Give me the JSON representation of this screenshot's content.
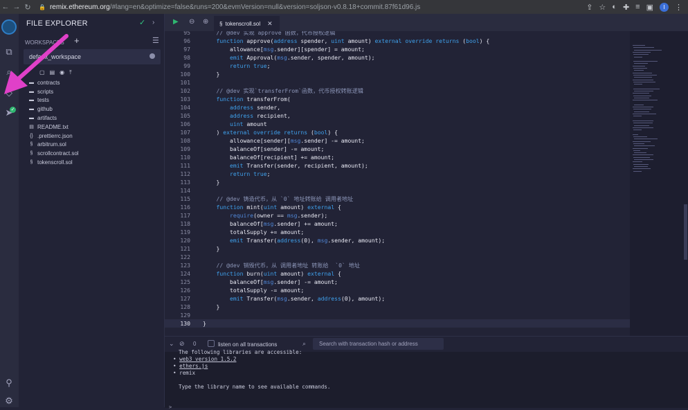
{
  "browser": {
    "url_host": "remix.ethereum.org",
    "url_rest": "/#lang=en&optimize=false&runs=200&evmVersion=null&version=soljson-v0.8.18+commit.87f61d96.js",
    "profile_initial": "I"
  },
  "explorer": {
    "title": "FILE EXPLORER",
    "workspaces_label": "WORKSPACES",
    "workspace_name": "default_workspace",
    "items": [
      {
        "name": "contracts",
        "icon": "folder-icon"
      },
      {
        "name": "scripts",
        "icon": "folder-icon"
      },
      {
        "name": "tests",
        "icon": "folder-icon"
      },
      {
        "name": "github",
        "icon": "folder-icon"
      },
      {
        "name": "artifacts",
        "icon": "folder-icon"
      },
      {
        "name": "README.txt",
        "icon": "file-text-icon"
      },
      {
        "name": ".prettierrc.json",
        "icon": "json-icon"
      },
      {
        "name": "arbitrum.sol",
        "icon": "solidity-icon"
      },
      {
        "name": "scrollcontract.sol",
        "icon": "solidity-icon"
      },
      {
        "name": "tokenscroll.sol",
        "icon": "solidity-icon"
      }
    ]
  },
  "editor": {
    "tab_name": "tokenscroll.sol",
    "active_line": 130,
    "lines": [
      {
        "n": 95,
        "tokens": [
          [
            "cm",
            "    // @dev 实现`approve`函数，代币授权逻辑"
          ]
        ]
      },
      {
        "n": 96,
        "tokens": [
          [
            "kw",
            "    function "
          ],
          [
            "nm",
            "approve("
          ],
          [
            "ty",
            "address "
          ],
          [
            "nm",
            "spender, "
          ],
          [
            "ty",
            "uint "
          ],
          [
            "nm",
            "amount) "
          ],
          [
            "kw",
            "external override returns "
          ],
          [
            "nm",
            "("
          ],
          [
            "ty",
            "bool"
          ],
          [
            "nm",
            ") {"
          ]
        ]
      },
      {
        "n": 97,
        "tokens": [
          [
            "nm",
            "        allowance["
          ],
          [
            "bi",
            "msg"
          ],
          [
            "nm",
            ".sender][spender] = amount;"
          ]
        ]
      },
      {
        "n": 98,
        "tokens": [
          [
            "kw",
            "        emit "
          ],
          [
            "nm",
            "Approval("
          ],
          [
            "bi",
            "msg"
          ],
          [
            "nm",
            ".sender, spender, amount);"
          ]
        ]
      },
      {
        "n": 99,
        "tokens": [
          [
            "kw",
            "        return true"
          ],
          [
            "nm",
            ";"
          ]
        ]
      },
      {
        "n": 100,
        "tokens": [
          [
            "nm",
            "    }"
          ]
        ]
      },
      {
        "n": 101,
        "tokens": []
      },
      {
        "n": 102,
        "tokens": [
          [
            "cm",
            "    // @dev 实现`transferFrom`函数，代币授权转账逻辑"
          ]
        ]
      },
      {
        "n": 103,
        "tokens": [
          [
            "kw",
            "    function "
          ],
          [
            "nm",
            "transferFrom("
          ]
        ]
      },
      {
        "n": 104,
        "tokens": [
          [
            "ty",
            "        address "
          ],
          [
            "nm",
            "sender,"
          ]
        ]
      },
      {
        "n": 105,
        "tokens": [
          [
            "ty",
            "        address "
          ],
          [
            "nm",
            "recipient,"
          ]
        ]
      },
      {
        "n": 106,
        "tokens": [
          [
            "ty",
            "        uint "
          ],
          [
            "nm",
            "amount"
          ]
        ]
      },
      {
        "n": 107,
        "tokens": [
          [
            "nm",
            "    ) "
          ],
          [
            "kw",
            "external override returns "
          ],
          [
            "nm",
            "("
          ],
          [
            "ty",
            "bool"
          ],
          [
            "nm",
            ") {"
          ]
        ]
      },
      {
        "n": 108,
        "tokens": [
          [
            "nm",
            "        allowance[sender]["
          ],
          [
            "bi",
            "msg"
          ],
          [
            "nm",
            ".sender] -= amount;"
          ]
        ]
      },
      {
        "n": 109,
        "tokens": [
          [
            "nm",
            "        balanceOf[sender] -= amount;"
          ]
        ]
      },
      {
        "n": 110,
        "tokens": [
          [
            "nm",
            "        balanceOf[recipient] += amount;"
          ]
        ]
      },
      {
        "n": 111,
        "tokens": [
          [
            "kw",
            "        emit "
          ],
          [
            "nm",
            "Transfer(sender, recipient, amount);"
          ]
        ]
      },
      {
        "n": 112,
        "tokens": [
          [
            "kw",
            "        return true"
          ],
          [
            "nm",
            ";"
          ]
        ]
      },
      {
        "n": 113,
        "tokens": [
          [
            "nm",
            "    }"
          ]
        ]
      },
      {
        "n": 114,
        "tokens": []
      },
      {
        "n": 115,
        "tokens": [
          [
            "cm",
            "    // @dev 铸造代币，从 `0` 地址转账给 调用者地址"
          ]
        ]
      },
      {
        "n": 116,
        "tokens": [
          [
            "kw",
            "    function "
          ],
          [
            "nm",
            "mint("
          ],
          [
            "ty",
            "uint "
          ],
          [
            "nm",
            "amount) "
          ],
          [
            "kw",
            "external "
          ],
          [
            "nm",
            "{"
          ]
        ]
      },
      {
        "n": 117,
        "tokens": [
          [
            "bi",
            "        require"
          ],
          [
            "nm",
            "(owner == "
          ],
          [
            "bi",
            "msg"
          ],
          [
            "nm",
            ".sender);"
          ]
        ]
      },
      {
        "n": 118,
        "tokens": [
          [
            "nm",
            "        balanceOf["
          ],
          [
            "bi",
            "msg"
          ],
          [
            "nm",
            ".sender] += amount;"
          ]
        ]
      },
      {
        "n": 119,
        "tokens": [
          [
            "nm",
            "        totalSupply += amount;"
          ]
        ]
      },
      {
        "n": 120,
        "tokens": [
          [
            "kw",
            "        emit "
          ],
          [
            "nm",
            "Transfer("
          ],
          [
            "ty",
            "address"
          ],
          [
            "nm",
            "(0), "
          ],
          [
            "bi",
            "msg"
          ],
          [
            "nm",
            ".sender, amount);"
          ]
        ]
      },
      {
        "n": 121,
        "tokens": [
          [
            "nm",
            "    }"
          ]
        ]
      },
      {
        "n": 122,
        "tokens": []
      },
      {
        "n": 123,
        "tokens": [
          [
            "cm",
            "    // @dev 销毁代币，从 调用者地址 转账给  `0` 地址"
          ]
        ]
      },
      {
        "n": 124,
        "tokens": [
          [
            "kw",
            "    function "
          ],
          [
            "nm",
            "burn("
          ],
          [
            "ty",
            "uint "
          ],
          [
            "nm",
            "amount) "
          ],
          [
            "kw",
            "external "
          ],
          [
            "nm",
            "{"
          ]
        ]
      },
      {
        "n": 125,
        "tokens": [
          [
            "nm",
            "        balanceOf["
          ],
          [
            "bi",
            "msg"
          ],
          [
            "nm",
            ".sender] -= amount;"
          ]
        ]
      },
      {
        "n": 126,
        "tokens": [
          [
            "nm",
            "        totalSupply -= amount;"
          ]
        ]
      },
      {
        "n": 127,
        "tokens": [
          [
            "kw",
            "        emit "
          ],
          [
            "nm",
            "Transfer("
          ],
          [
            "bi",
            "msg"
          ],
          [
            "nm",
            ".sender, "
          ],
          [
            "ty",
            "address"
          ],
          [
            "nm",
            "(0), amount);"
          ]
        ]
      },
      {
        "n": 128,
        "tokens": [
          [
            "nm",
            "    }"
          ]
        ]
      },
      {
        "n": 129,
        "tokens": []
      },
      {
        "n": 130,
        "tokens": [
          [
            "nm",
            "}"
          ]
        ]
      }
    ]
  },
  "terminal": {
    "tx_count": "0",
    "listen_label": "listen on all transactions",
    "search_placeholder": "Search with transaction hash or address",
    "lines": [
      {
        "text": "The following libraries are accessible:",
        "link": false,
        "indent": 0
      },
      {
        "text": "web3 version 1.5.2",
        "link": true,
        "indent": 1
      },
      {
        "text": "ethers.js",
        "link": true,
        "indent": 1
      },
      {
        "text": "remix",
        "link": false,
        "indent": 1
      },
      {
        "text": "",
        "link": false,
        "indent": 0
      },
      {
        "text": "Type the library name to see available commands.",
        "link": false,
        "indent": 0
      }
    ]
  },
  "colors": {
    "accent_green": "#2fb670",
    "annotation_arrow": "#e040c8",
    "keyword_blue": "#3fa1ed"
  }
}
